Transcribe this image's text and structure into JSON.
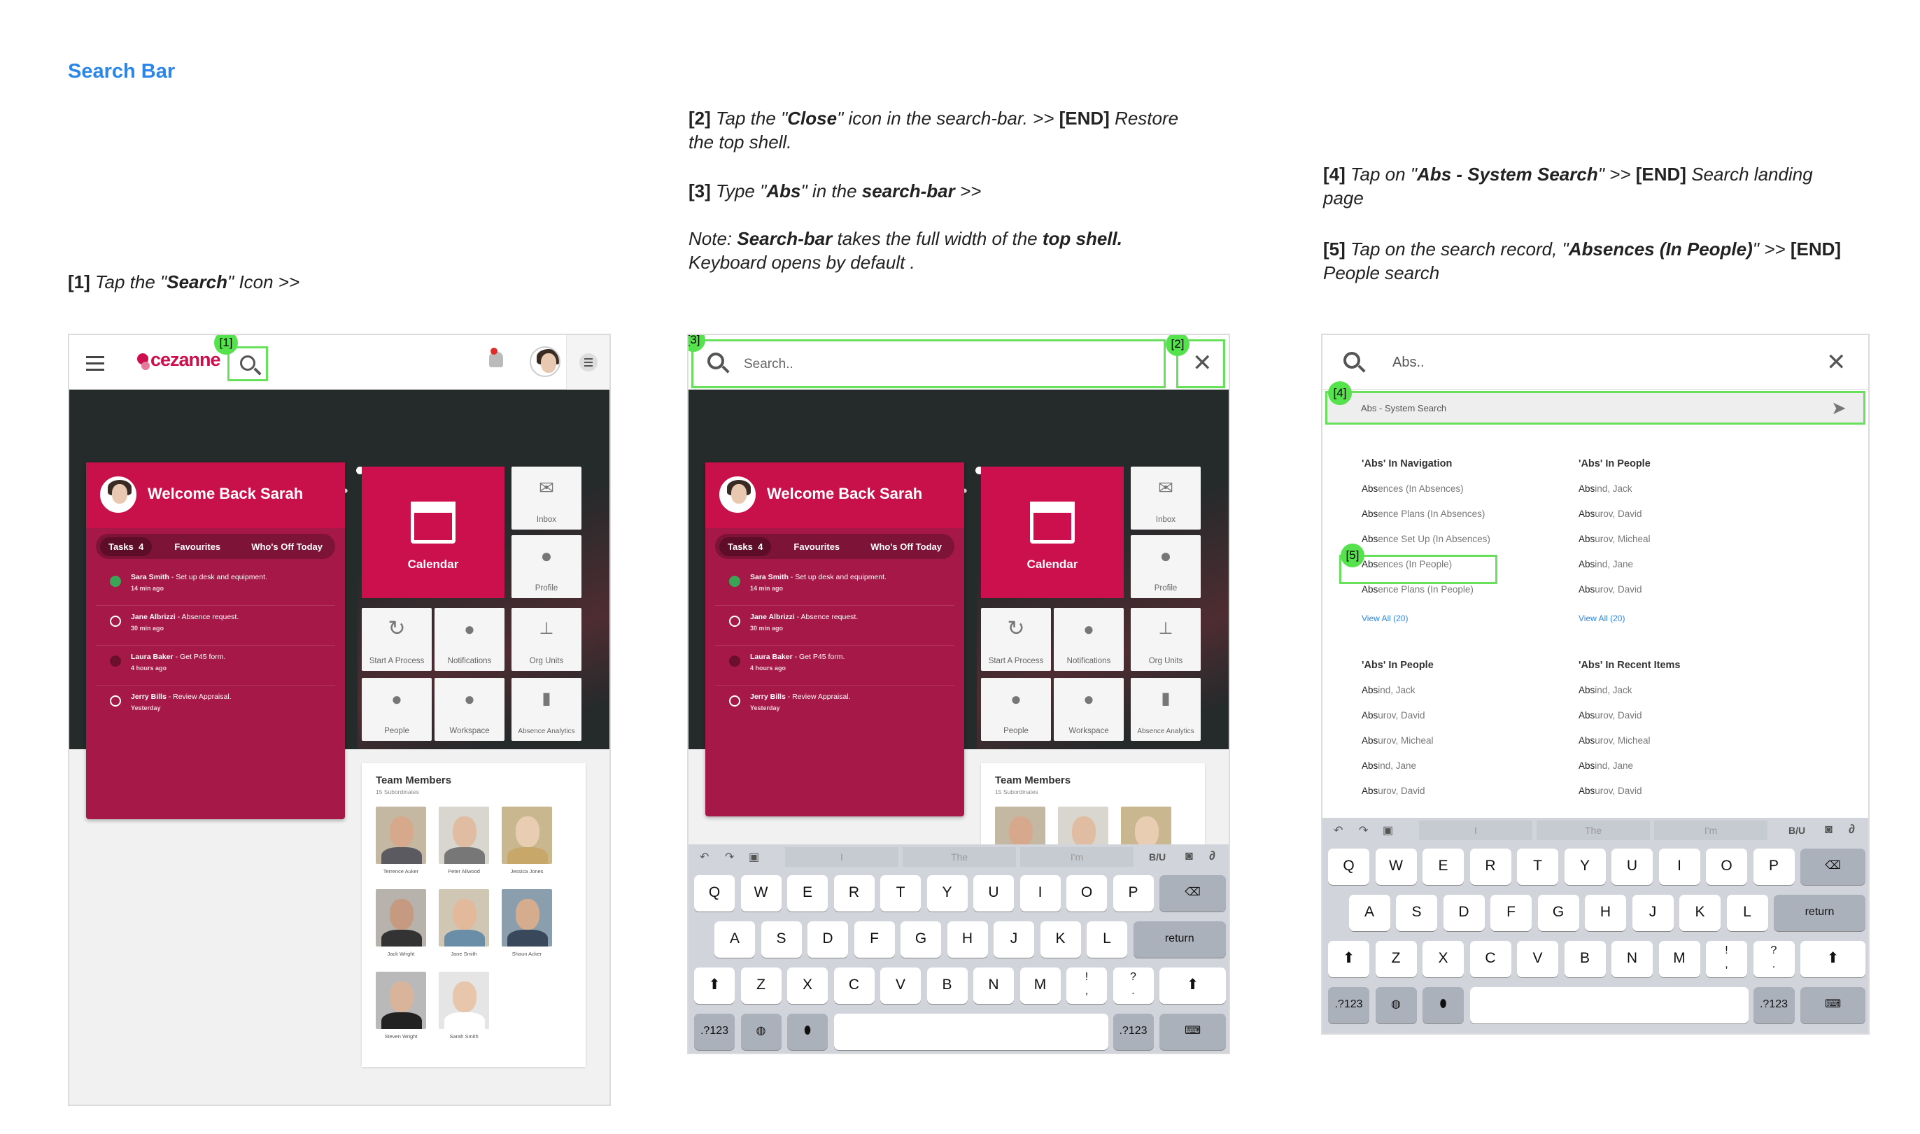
{
  "page": {
    "title": "Search Bar"
  },
  "notes": {
    "n1": {
      "num": "[1]",
      "pre": " Tap the \"",
      "b1": "Search",
      "post": "\" Icon >>"
    },
    "n2": {
      "num": "[2]",
      "pre": " Tap the \"",
      "b1": "Close",
      "mid": "\" icon in the search-bar.  >> ",
      "end": "[END]",
      "post": " Restore the top shell."
    },
    "n3": {
      "num": "[3]",
      "pre": " Type \"",
      "b1": "Abs",
      "mid": "\" in the ",
      "b2": "search-bar",
      "post": " >>"
    },
    "note": {
      "lead": "Note: ",
      "b1": "Search-bar",
      "mid": " takes the full width of the ",
      "b2": "top shell.",
      "post": "Keyboard opens by default ."
    },
    "n4": {
      "num": "[4]",
      "pre": " Tap on \"",
      "b1": "Abs - System Search",
      "mid": "\" >> ",
      "end": "[END]",
      "post": " Search landing page"
    },
    "n5": {
      "num": "[5]",
      "pre": " Tap on the search record, \"",
      "b1": "Absences (In People)",
      "mid": "\"  >> ",
      "end": "[END]",
      "post": " People search"
    }
  },
  "labels": {
    "l1": "[1]",
    "l2": "[2]",
    "l3": "[3]",
    "l4": "[4]",
    "l5": "[5]"
  },
  "app": {
    "brand": "cezanne",
    "welcome": "Welcome Back Sarah",
    "tabs": [
      {
        "label": "Tasks",
        "count": "4"
      },
      {
        "label": "Favourites"
      },
      {
        "label": "Who's Off Today"
      }
    ],
    "tasks": [
      {
        "who": "Sara Smith",
        "what": " - Set up desk and equipment.",
        "time": "14 min ago",
        "state": "done"
      },
      {
        "who": "Jane Albrizzi",
        "what": " - Absence request.",
        "time": "30 min ago",
        "state": "open"
      },
      {
        "who": "Laura Baker",
        "what": " - Get P45 form.",
        "time": "4 hours ago",
        "state": "dot"
      },
      {
        "who": "Jerry Bills",
        "what": " - Review Appraisal.",
        "time": "Yesterday",
        "state": "open"
      }
    ],
    "tiles": {
      "calendar": "Calendar",
      "inbox": "Inbox",
      "profile": "Profile",
      "start": "Start A Process",
      "notifications": "Notifications",
      "org": "Org Units",
      "people": "People",
      "workspace": "Workspace",
      "analytics": "Absence Analytics"
    },
    "team": {
      "title": "Team Members",
      "sub": "15 Subordinates",
      "members": [
        "Terrence Auker",
        "Peter Allwood",
        "Jessica Jones",
        "Jack Wright",
        "Jane Smith",
        "Shaun Acker",
        "Steven Wright",
        "Sarah Smith"
      ]
    }
  },
  "search": {
    "placeholder": "Search..",
    "query": "Abs..",
    "system": "Abs - System Search"
  },
  "results": {
    "nav": {
      "title": "'Abs' In Navigation",
      "items": [
        {
          "b": "Abs",
          "r": "ences (In Absences)"
        },
        {
          "b": "Abs",
          "r": "ence Plans (In Absences)"
        },
        {
          "b": "Abs",
          "r": "ence Set Up (In Absences)"
        },
        {
          "b": "Abs",
          "r": "ences (In People)"
        },
        {
          "b": "Abs",
          "r": "ence Plans (In People)"
        }
      ],
      "viewall": "View All (20)"
    },
    "people1": {
      "title": "'Abs' In People",
      "items": [
        {
          "b": "Abs",
          "r": "ind, Jack"
        },
        {
          "b": "Abs",
          "r": "urov, David"
        },
        {
          "b": "Abs",
          "r": "urov, Micheal"
        },
        {
          "b": "Abs",
          "r": "ind, Jane"
        },
        {
          "b": "Abs",
          "r": "urov, David"
        }
      ],
      "viewall": "View All (20)"
    },
    "people2": {
      "title": "'Abs' In People",
      "items": [
        {
          "b": "Abs",
          "r": "ind, Jack"
        },
        {
          "b": "Abs",
          "r": "urov, David"
        },
        {
          "b": "Abs",
          "r": "urov, Micheal"
        },
        {
          "b": "Abs",
          "r": "ind, Jane"
        },
        {
          "b": "Abs",
          "r": "urov, David"
        }
      ]
    },
    "recent": {
      "title": "'Abs' In Recent Items",
      "items": [
        {
          "b": "Abs",
          "r": "ind, Jack"
        },
        {
          "b": "Abs",
          "r": "urov, David"
        },
        {
          "b": "Abs",
          "r": "urov, Micheal"
        },
        {
          "b": "Abs",
          "r": "ind, Jane"
        },
        {
          "b": "Abs",
          "r": "urov, David"
        }
      ]
    }
  },
  "keyboard": {
    "row1": [
      "Q",
      "W",
      "E",
      "R",
      "T",
      "Y",
      "U",
      "I",
      "O",
      "P"
    ],
    "row2": [
      "A",
      "S",
      "D",
      "F",
      "G",
      "H",
      "J",
      "K",
      "L"
    ],
    "row3": [
      "Z",
      "X",
      "C",
      "V",
      "B",
      "N",
      "M",
      "!\n,",
      "?\n."
    ],
    "ret": "return",
    "num": ".?123",
    "suggest": [
      "I",
      "The",
      "I'm"
    ],
    "biu": "B/U"
  },
  "colors": {
    "accent": "#2b86e8",
    "brand": "#cc0f4d",
    "highlight": "#69e05c"
  }
}
